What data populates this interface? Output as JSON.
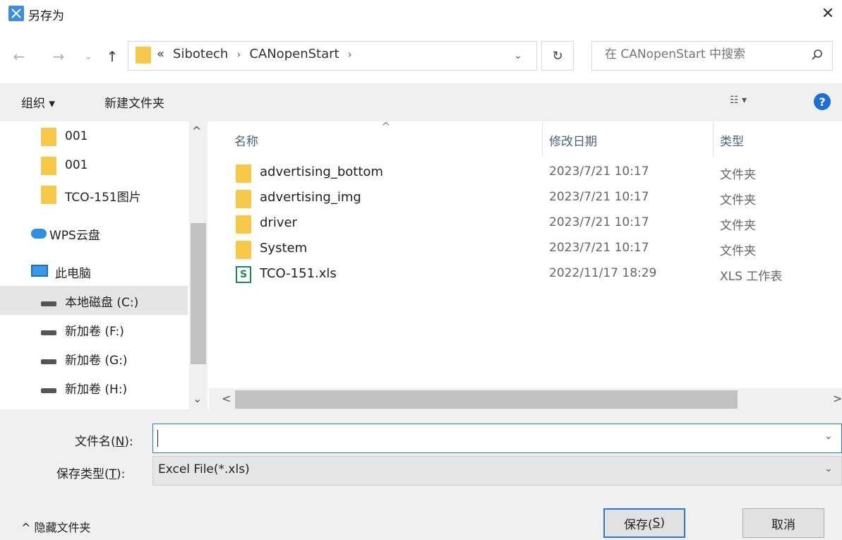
{
  "window": {
    "title": "另存为",
    "close_glyph": "✕"
  },
  "nav": {
    "back_glyph": "←",
    "forward_glyph": "→",
    "recent_glyph": "⌄",
    "up_glyph": "↑",
    "address_prefix": "«",
    "breadcrumbs": [
      "Sibotech",
      "CANopenStart"
    ],
    "crumb_sep": "›",
    "dropdown_glyph": "⌄",
    "refresh_glyph": "↻",
    "search_placeholder": "在 CANopenStart 中搜索"
  },
  "toolbar": {
    "organize_label": "组织 ▾",
    "new_folder_label": "新建文件夹",
    "view_label": "☷ ▾",
    "help_glyph": "?"
  },
  "sidebar": {
    "items": [
      {
        "label": "001",
        "icon": "folder-icon"
      },
      {
        "label": "001",
        "icon": "folder-icon"
      },
      {
        "label": "TCO-151图片",
        "icon": "folder-icon"
      },
      {
        "label": "WPS云盘",
        "icon": "cloud-icon"
      },
      {
        "label": "此电脑",
        "icon": "computer-icon"
      },
      {
        "label": "本地磁盘 (C:)",
        "icon": "drive-icon",
        "selected": true
      },
      {
        "label": "新加卷 (F:)",
        "icon": "drive-icon"
      },
      {
        "label": "新加卷 (G:)",
        "icon": "drive-icon"
      },
      {
        "label": "新加卷 (H:)",
        "icon": "drive-icon"
      }
    ],
    "scroll_up_glyph": "^",
    "scroll_down_glyph": "⌄"
  },
  "file_list": {
    "columns": {
      "name": "名称",
      "modified": "修改日期",
      "type": "类型"
    },
    "sort_glyph": "^",
    "rows": [
      {
        "name": "advertising_bottom",
        "modified": "2023/7/21 10:17",
        "type": "文件夹",
        "icon": "folder-icon"
      },
      {
        "name": "advertising_img",
        "modified": "2023/7/21 10:17",
        "type": "文件夹",
        "icon": "folder-icon"
      },
      {
        "name": "driver",
        "modified": "2023/7/21 10:17",
        "type": "文件夹",
        "icon": "folder-icon"
      },
      {
        "name": "System",
        "modified": "2023/7/21 10:17",
        "type": "文件夹",
        "icon": "folder-icon"
      },
      {
        "name": "TCO-151.xls",
        "modified": "2022/11/17 18:29",
        "type": "XLS 工作表",
        "icon": "xls-icon",
        "icon_letter": "S"
      }
    ],
    "hscroll_left_glyph": "<",
    "hscroll_right_glyph": ">"
  },
  "form": {
    "filename_label_pre": "文件名(",
    "filename_label_key": "N",
    "filename_label_post": "):",
    "filename_value": "",
    "filetype_label_pre": "保存类型(",
    "filetype_label_key": "T",
    "filetype_label_post": "):",
    "filetype_value": "Excel File(*.xls)",
    "dropdown_glyph": "⌄"
  },
  "footer": {
    "hide_folders_label": "^  隐藏文件夹",
    "save_pre": "保存(",
    "save_key": "S",
    "save_post": ")",
    "cancel_label": "取消"
  },
  "colors": {
    "accent": "#2878d8",
    "folder": "#f8c84a",
    "selected_bg": "#e5e5e5",
    "chrome_bg": "#f0f0f0"
  }
}
